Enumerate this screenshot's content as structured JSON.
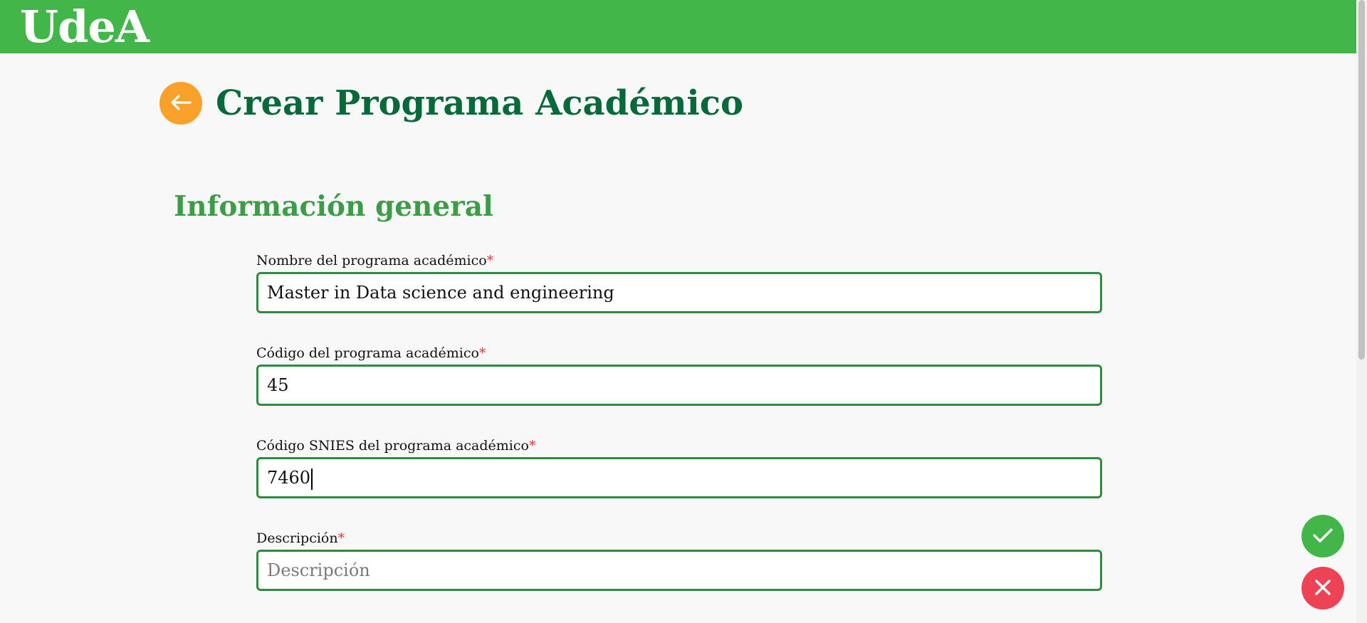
{
  "header": {
    "logo_text": "UdeA",
    "brand_color": "#43b649"
  },
  "page": {
    "title": "Crear Programa Académico",
    "back_icon": "arrow-left-icon"
  },
  "section": {
    "title": "Información general"
  },
  "form": {
    "required_marker": "*",
    "fields": [
      {
        "label": "Nombre del programa académico",
        "value": "Master in Data science and engineering",
        "placeholder": ""
      },
      {
        "label": "Código del programa académico",
        "value": "45",
        "placeholder": ""
      },
      {
        "label": "Código SNIES del programa académico",
        "value": "7460",
        "placeholder": ""
      },
      {
        "label": "Descripción",
        "value": "",
        "placeholder": "Descripción"
      }
    ]
  },
  "actions": {
    "confirm_icon": "check-icon",
    "cancel_icon": "close-icon",
    "confirm_color": "#43b649",
    "cancel_color": "#ee4354"
  },
  "colors": {
    "title": "#06693a",
    "section_title": "#3e9b48",
    "back_button": "#f9a12b",
    "input_border": "#2e8b3f"
  }
}
